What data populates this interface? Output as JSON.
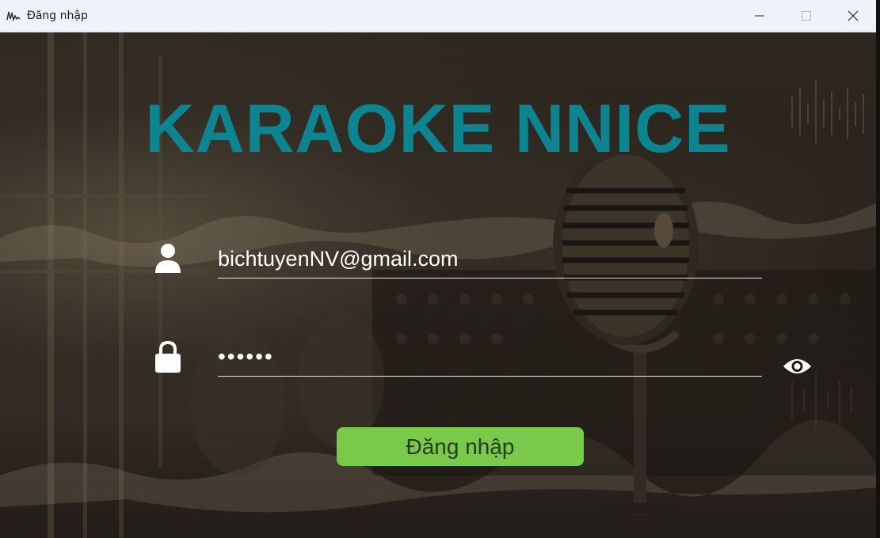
{
  "window": {
    "title": "Đăng nhập",
    "icon": "app-waveform-icon",
    "controls": [
      "minimize-icon",
      "maximize-icon",
      "close-icon"
    ]
  },
  "login": {
    "app_title": "KARAOKE NNICE",
    "email_value": "bichtuyenNV@gmail.com",
    "password_value": "••••••",
    "user_icon": "user-icon",
    "lock_icon": "lock-icon",
    "show_password_icon": "eye-icon",
    "submit_label": "Đăng nhập"
  },
  "colors": {
    "title": "#0d8591",
    "button": "#79c94a",
    "button_text": "#2b3a25",
    "field_text": "#ffffff"
  }
}
